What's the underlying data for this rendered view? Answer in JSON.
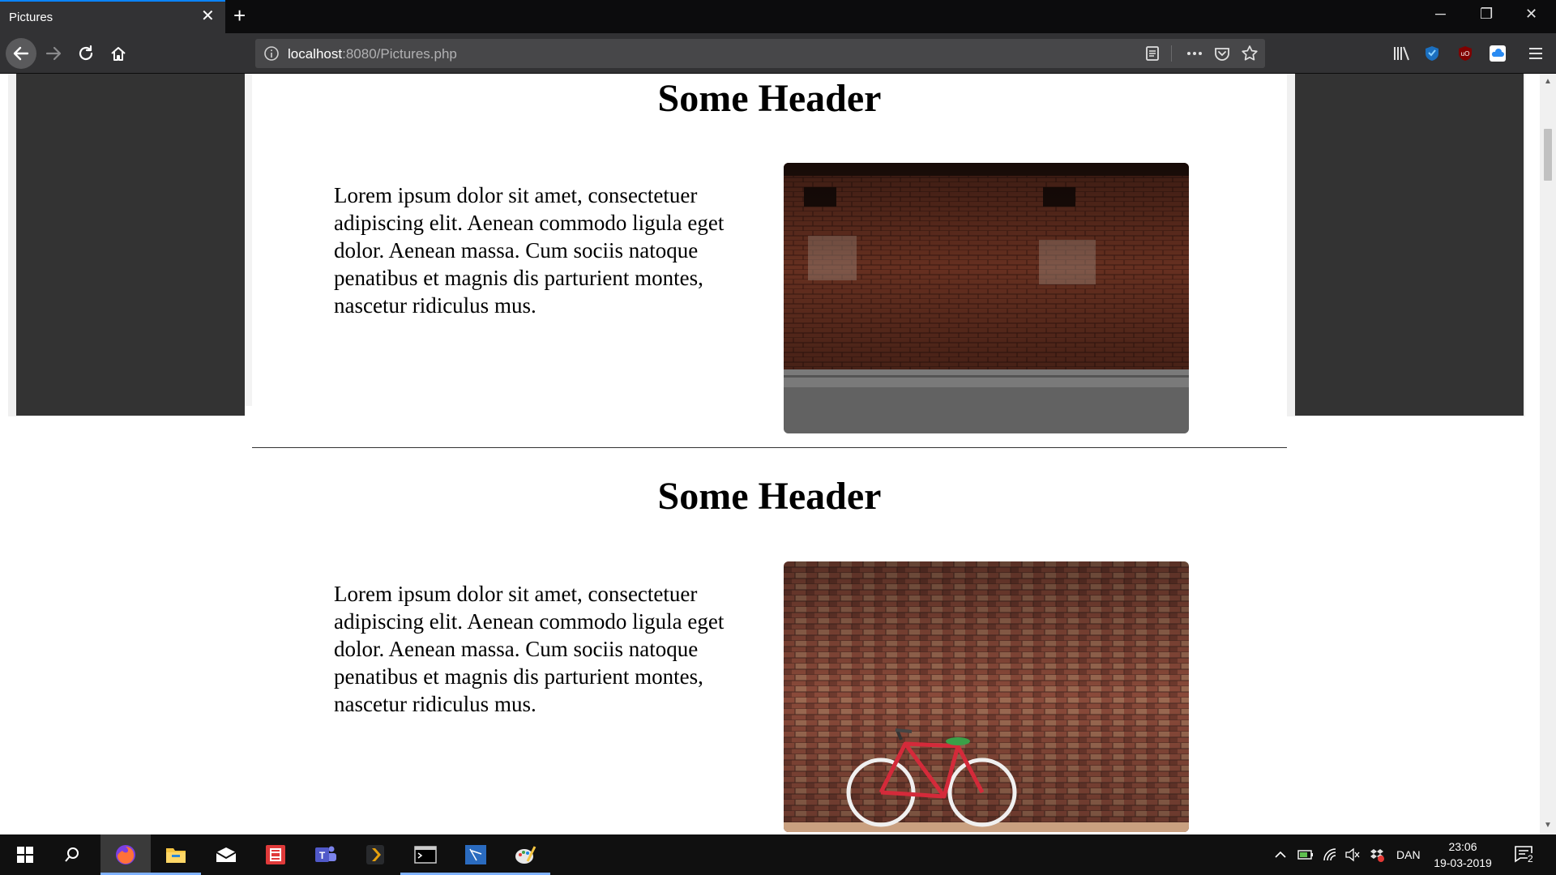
{
  "browser": {
    "tab_title": "Pictures",
    "tab_close": "✕",
    "new_tab": "+",
    "url_host": "localhost",
    "url_rest": ":8080/Pictures.php",
    "window_controls": {
      "minimize": "─",
      "restore": "❐",
      "close": "✕"
    },
    "accent": "#0a84ff"
  },
  "page": {
    "sections": [
      {
        "header": "Some Header",
        "text": "Lorem ipsum dolor sit amet, consectetuer adipiscing elit. Aenean commodo ligula eget dolor. Aenean massa. Cum sociis natoque penatibus et magnis dis parturient montes, nascetur ridiculus mus.",
        "image": "brick-wall-sidewalk"
      },
      {
        "header": "Some Header",
        "text": "Lorem ipsum dolor sit amet, consectetuer adipiscing elit. Aenean commodo ligula eget dolor. Aenean massa. Cum sociis natoque penatibus et magnis dis parturient montes, nascetur ridiculus mus.",
        "image": "brick-wall-red-bicycle"
      }
    ],
    "side_panel_color": "#333333"
  },
  "taskbar": {
    "apps": [
      "windows-start-icon",
      "search-icon",
      "firefox-icon",
      "file-explorer-icon",
      "mail-icon",
      "media-player-icon",
      "teams-icon",
      "plex-icon",
      "terminal-icon",
      "visual-studio-icon",
      "paint-icon"
    ],
    "language": "DAN",
    "time": "23:06",
    "date": "19-03-2019",
    "notification_count": "2"
  }
}
